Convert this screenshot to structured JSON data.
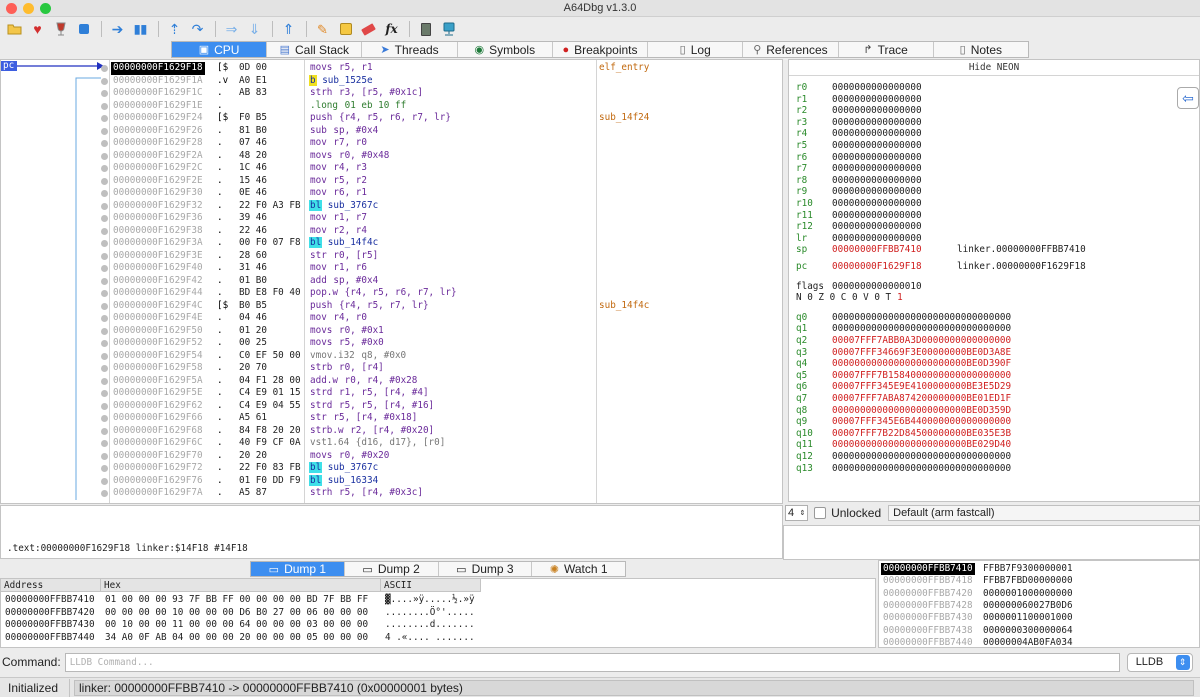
{
  "window": {
    "title": "A64Dbg v1.3.0"
  },
  "toolbar": {
    "icons": [
      "open-folder-icon",
      "heart-icon",
      "wine-glass-icon",
      "stop-icon",
      "step-into-icon",
      "pause-icon",
      "step-over-icon",
      "continue-icon",
      "arrow-right-icon",
      "arrow-down-icon",
      "arrow-up-icon",
      "pencil-icon",
      "note-icon",
      "eraser-icon",
      "fx-icon",
      "calculator-icon",
      "network-icon"
    ],
    "glyphs": {
      "fx": "fx"
    }
  },
  "tabs": [
    {
      "label": "CPU",
      "icon": "cpu-icon",
      "active": true
    },
    {
      "label": "Call Stack",
      "icon": "stack-icon"
    },
    {
      "label": "Threads",
      "icon": "threads-icon"
    },
    {
      "label": "Symbols",
      "icon": "symbols-icon"
    },
    {
      "label": "Breakpoints",
      "icon": "breakpoint-icon"
    },
    {
      "label": "Log",
      "icon": "log-icon"
    },
    {
      "label": "References",
      "icon": "search-icon"
    },
    {
      "label": "Trace",
      "icon": "trace-icon"
    },
    {
      "label": "Notes",
      "icon": "notes-icon"
    }
  ],
  "disasm": {
    "pc_label": "pc",
    "rows": [
      {
        "addr": "00000000F1629F18",
        "mark": "[$",
        "bytes": "0D 00",
        "mn": "movs",
        "ops": " r5, r1",
        "label": "elf_entry",
        "current": true,
        "style": "t-purple"
      },
      {
        "addr": "00000000F1629F1A",
        "mark": ".v",
        "bytes": "A0 E1",
        "mn": "b",
        "ops": " sub_1525e",
        "hl": "hl-y",
        "style": "t-blue"
      },
      {
        "addr": "00000000F1629F1C",
        "mark": ".",
        "bytes": "AB 83",
        "mn": "strh",
        "ops": " r3, [r5, #0x1c]",
        "style": "t-purple"
      },
      {
        "addr": "00000000F1629F1E",
        "mark": ".",
        "bytes": "",
        "mn": ".long",
        "ops": " 01 eb 10 ff",
        "style": "t-green"
      },
      {
        "addr": "00000000F1629F24",
        "mark": "[$",
        "bytes": "F0 B5",
        "mn": "push",
        "ops": " {r4, r5, r6, r7, lr}",
        "label": "sub_14f24",
        "style": "t-purple"
      },
      {
        "addr": "00000000F1629F26",
        "mark": ".",
        "bytes": "81 B0",
        "mn": "sub",
        "ops": " sp, #0x4",
        "style": "t-purple"
      },
      {
        "addr": "00000000F1629F28",
        "mark": ".",
        "bytes": "07 46",
        "mn": "mov",
        "ops": " r7, r0",
        "style": "t-purple"
      },
      {
        "addr": "00000000F1629F2A",
        "mark": ".",
        "bytes": "48 20",
        "mn": "movs",
        "ops": " r0, #0x48",
        "style": "t-purple"
      },
      {
        "addr": "00000000F1629F2C",
        "mark": ".",
        "bytes": "1C 46",
        "mn": "mov",
        "ops": " r4, r3",
        "style": "t-purple"
      },
      {
        "addr": "00000000F1629F2E",
        "mark": ".",
        "bytes": "15 46",
        "mn": "mov",
        "ops": " r5, r2",
        "style": "t-purple"
      },
      {
        "addr": "00000000F1629F30",
        "mark": ".",
        "bytes": "0E 46",
        "mn": "mov",
        "ops": " r6, r1",
        "style": "t-purple"
      },
      {
        "addr": "00000000F1629F32",
        "mark": ".",
        "bytes": "22 F0 A3 FB",
        "mn": "bl",
        "ops": " sub_3767c",
        "hl": "hl-c",
        "style": "t-blue"
      },
      {
        "addr": "00000000F1629F36",
        "mark": ".",
        "bytes": "39 46",
        "mn": "mov",
        "ops": " r1, r7",
        "style": "t-purple"
      },
      {
        "addr": "00000000F1629F38",
        "mark": ".",
        "bytes": "22 46",
        "mn": "mov",
        "ops": " r2, r4",
        "style": "t-purple"
      },
      {
        "addr": "00000000F1629F3A",
        "mark": ".",
        "bytes": "00 F0 07 F8",
        "mn": "bl",
        "ops": " sub_14f4c",
        "hl": "hl-c",
        "style": "t-blue"
      },
      {
        "addr": "00000000F1629F3E",
        "mark": ".",
        "bytes": "28 60",
        "mn": "str",
        "ops": " r0, [r5]",
        "style": "t-purple"
      },
      {
        "addr": "00000000F1629F40",
        "mark": ".",
        "bytes": "31 46",
        "mn": "mov",
        "ops": " r1, r6",
        "style": "t-purple"
      },
      {
        "addr": "00000000F1629F42",
        "mark": ".",
        "bytes": "01 B0",
        "mn": "add",
        "ops": " sp, #0x4",
        "style": "t-purple"
      },
      {
        "addr": "00000000F1629F44",
        "mark": ".",
        "bytes": "BD E8 F0 40",
        "mn": "pop.w",
        "ops": " {r4, r5, r6, r7, lr}",
        "style": "t-purple"
      },
      {
        "addr": "00000000F1629F4C",
        "mark": "[$",
        "bytes": "B0 B5",
        "mn": "push",
        "ops": " {r4, r5, r7, lr}",
        "label": "sub_14f4c",
        "style": "t-purple"
      },
      {
        "addr": "00000000F1629F4E",
        "mark": ".",
        "bytes": "04 46",
        "mn": "mov",
        "ops": " r4, r0",
        "style": "t-purple"
      },
      {
        "addr": "00000000F1629F50",
        "mark": ".",
        "bytes": "01 20",
        "mn": "movs",
        "ops": " r0, #0x1",
        "style": "t-purple"
      },
      {
        "addr": "00000000F1629F52",
        "mark": ".",
        "bytes": "00 25",
        "mn": "movs",
        "ops": " r5, #0x0",
        "style": "t-purple"
      },
      {
        "addr": "00000000F1629F54",
        "mark": ".",
        "bytes": "C0 EF 50 00",
        "mn": "vmov.i32",
        "ops": " q8, #0x0",
        "style": "t-gray"
      },
      {
        "addr": "00000000F1629F58",
        "mark": ".",
        "bytes": "20 70",
        "mn": "strb",
        "ops": " r0, [r4]",
        "style": "t-purple"
      },
      {
        "addr": "00000000F1629F5A",
        "mark": ".",
        "bytes": "04 F1 28 00",
        "mn": "add.w",
        "ops": " r0, r4, #0x28",
        "style": "t-purple"
      },
      {
        "addr": "00000000F1629F5E",
        "mark": ".",
        "bytes": "C4 E9 01 15",
        "mn": "strd",
        "ops": " r1, r5, [r4, #4]",
        "style": "t-purple"
      },
      {
        "addr": "00000000F1629F62",
        "mark": ".",
        "bytes": "C4 E9 04 55",
        "mn": "strd",
        "ops": " r5, r5, [r4, #16]",
        "style": "t-purple"
      },
      {
        "addr": "00000000F1629F66",
        "mark": ".",
        "bytes": "A5 61",
        "mn": "str",
        "ops": " r5, [r4, #0x18]",
        "style": "t-purple"
      },
      {
        "addr": "00000000F1629F68",
        "mark": ".",
        "bytes": "84 F8 20 20",
        "mn": "strb.w",
        "ops": " r2, [r4, #0x20]",
        "style": "t-purple"
      },
      {
        "addr": "00000000F1629F6C",
        "mark": ".",
        "bytes": "40 F9 CF 0A",
        "mn": "vst1.64",
        "ops": " {d16, d17}, [r0]",
        "style": "t-gray"
      },
      {
        "addr": "00000000F1629F70",
        "mark": ".",
        "bytes": "20 20",
        "mn": "movs",
        "ops": " r0, #0x20",
        "style": "t-purple"
      },
      {
        "addr": "00000000F1629F72",
        "mark": ".",
        "bytes": "22 F0 83 FB",
        "mn": "bl",
        "ops": " sub_3767c",
        "hl": "hl-c",
        "style": "t-blue"
      },
      {
        "addr": "00000000F1629F76",
        "mark": ".",
        "bytes": "01 F0 DD F9",
        "mn": "bl",
        "ops": " sub_16334",
        "hl": "hl-c",
        "style": "t-blue"
      },
      {
        "addr": "00000000F1629F7A",
        "mark": ".",
        "bytes": "A5 87",
        "mn": "strh",
        "ops": " r5, [r4, #0x3c]",
        "style": "t-purple"
      }
    ],
    "info_text": ".text:00000000F1629F18 linker:$14F18 #14F18"
  },
  "registers": {
    "hide_label": "Hide NEON",
    "gp": [
      {
        "name": "r0",
        "value": "0000000000000000"
      },
      {
        "name": "r1",
        "value": "0000000000000000"
      },
      {
        "name": "r2",
        "value": "0000000000000000"
      },
      {
        "name": "r3",
        "value": "0000000000000000"
      },
      {
        "name": "r4",
        "value": "0000000000000000"
      },
      {
        "name": "r5",
        "value": "0000000000000000"
      },
      {
        "name": "r6",
        "value": "0000000000000000"
      },
      {
        "name": "r7",
        "value": "0000000000000000"
      },
      {
        "name": "r8",
        "value": "0000000000000000"
      },
      {
        "name": "r9",
        "value": "0000000000000000"
      },
      {
        "name": "r10",
        "value": "0000000000000000"
      },
      {
        "name": "r11",
        "value": "0000000000000000"
      },
      {
        "name": "r12",
        "value": "0000000000000000"
      },
      {
        "name": "lr",
        "value": "0000000000000000"
      },
      {
        "name": "sp",
        "value": "00000000FFBB7410",
        "red": true,
        "extra": "linker.00000000FFBB7410"
      }
    ],
    "pc": {
      "name": "pc",
      "value": "00000000F1629F18",
      "red": true,
      "extra": "linker.00000000F1629F18"
    },
    "flags": {
      "name": "flags",
      "value": "0000000000000010",
      "bits": "N 0 Z 0 C 0 V 0 T",
      "tbit": "1"
    },
    "neon": [
      {
        "name": "q0",
        "value": "00000000000000000000000000000000"
      },
      {
        "name": "q1",
        "value": "00000000000000000000000000000000"
      },
      {
        "name": "q2",
        "value": "00007FFF7ABB0A3D0000000000000000",
        "red": true
      },
      {
        "name": "q3",
        "value": "00007FFF34669F3E00000000BE0D3A8E",
        "red": true
      },
      {
        "name": "q4",
        "value": "000000000000000000000000BE0D390F",
        "red": true
      },
      {
        "name": "q5",
        "value": "00007FFF7B1584000000000000000000",
        "red": true
      },
      {
        "name": "q6",
        "value": "00007FFF345E9E4100000000BE3E5D29",
        "red": true
      },
      {
        "name": "q7",
        "value": "00007FFF7ABA874200000000BE01ED1F",
        "red": true
      },
      {
        "name": "q8",
        "value": "000000000000000000000000BE0D359D",
        "red": true
      },
      {
        "name": "q9",
        "value": "00007FFF345E6B440000000000000000",
        "red": true
      },
      {
        "name": "q10",
        "value": "00007FFF7B22D84500000000BE035E3B",
        "red": true
      },
      {
        "name": "q11",
        "value": "000000000000000000000000BE029D40",
        "red": true
      },
      {
        "name": "q12",
        "value": "00000000000000000000000000000000"
      },
      {
        "name": "q13",
        "value": "00000000000000000000000000000000"
      }
    ],
    "arg_count": "4",
    "unlocked_label": "Unlocked",
    "calling_convention": "Default (arm fastcall)"
  },
  "dump": {
    "tabs": [
      {
        "label": "Dump 1",
        "active": true
      },
      {
        "label": "Dump 2"
      },
      {
        "label": "Dump 3"
      },
      {
        "label": "Watch 1"
      }
    ],
    "headers": {
      "address": "Address",
      "hex": "Hex",
      "ascii": "ASCII"
    },
    "rows": [
      {
        "addr": "00000000FFBB7410",
        "hex": "01 00 00 00 93 7F BB FF 00 00 00 00 BD 7F BB FF",
        "ascii": "▓....»ÿ.....½.»ÿ"
      },
      {
        "addr": "00000000FFBB7420",
        "hex": "00 00 00 00 10 00 00 00 D6 B0 27 00 06 00 00 00",
        "ascii": "........Ö°'....."
      },
      {
        "addr": "00000000FFBB7430",
        "hex": "00 10 00 00 11 00 00 00 64 00 00 00 03 00 00 00",
        "ascii": "........d......."
      },
      {
        "addr": "00000000FFBB7440",
        "hex": "34 A0 0F AB 04 00 00 00 20 00 00 00 05 00 00 00",
        "ascii": "4 .«.... ......."
      }
    ]
  },
  "stack": [
    {
      "addr": "00000000FFBB7410",
      "value": "FFBB7F9300000001",
      "current": true
    },
    {
      "addr": "00000000FFBB7418",
      "value": "FFBB7FBD00000000"
    },
    {
      "addr": "00000000FFBB7420",
      "value": "0000001000000000"
    },
    {
      "addr": "00000000FFBB7428",
      "value": "000000060027B0D6"
    },
    {
      "addr": "00000000FFBB7430",
      "value": "0000001100001000"
    },
    {
      "addr": "00000000FFBB7438",
      "value": "0000000300000064"
    },
    {
      "addr": "00000000FFBB7440",
      "value": "00000004AB0FA034"
    }
  ],
  "command": {
    "label": "Command:",
    "placeholder": "LLDB Command...",
    "engine": "LLDB"
  },
  "status": {
    "state": "Initialized",
    "message": "linker: 00000000FFBB7410 -> 00000000FFBB7410 (0x00000001 bytes)"
  }
}
